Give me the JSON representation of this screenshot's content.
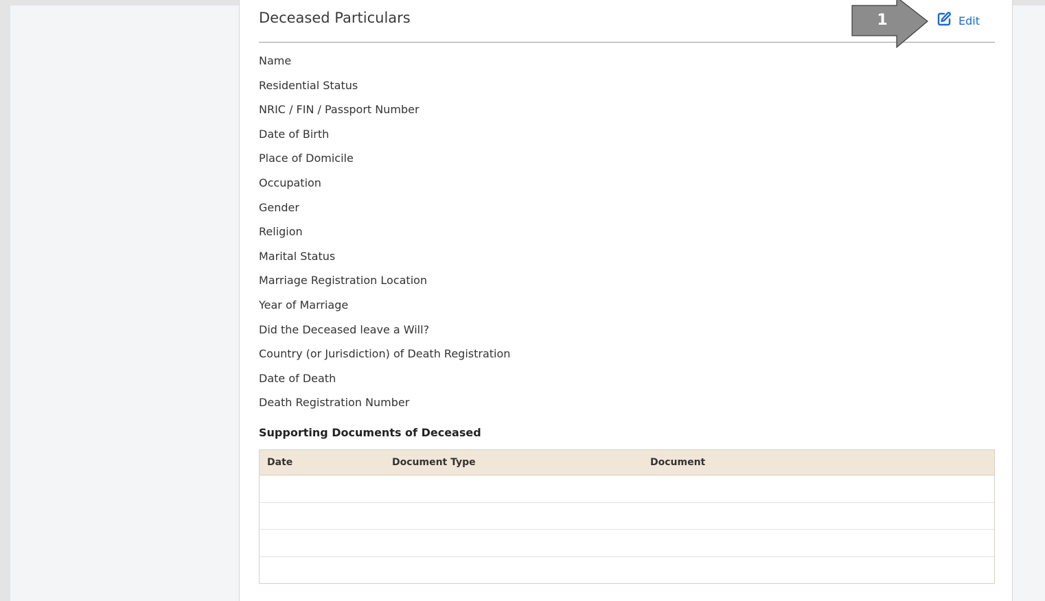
{
  "section": {
    "title": "Deceased Particulars",
    "edit_label": "Edit"
  },
  "fields": [
    "Name",
    "Residential Status",
    "NRIC / FIN / Passport Number",
    "Date of Birth",
    "Place of Domicile",
    "Occupation",
    "Gender",
    "Religion",
    "Marital Status",
    "Marriage Registration Location",
    "Year of Marriage",
    "Did the Deceased leave a Will?",
    "Country (or Jurisdiction) of Death Registration",
    "Date of Death",
    "Death Registration Number"
  ],
  "documents": {
    "heading": "Supporting Documents of Deceased",
    "columns": [
      "Date",
      "Document Type",
      "Document"
    ],
    "rows": []
  },
  "annotation": {
    "number": "1"
  },
  "colors": {
    "accent": "#1a6ad0",
    "table_header_bg": "#f1e7d9",
    "callout_fill": "#8c8c8c"
  },
  "icons": {
    "edit": "edit-square-pen-icon"
  }
}
